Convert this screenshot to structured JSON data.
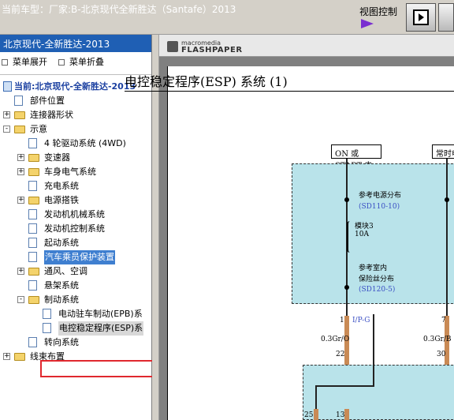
{
  "topbar": {
    "title": "当前车型：厂家:B-北京现代全新胜达（Santafe）2013",
    "view_control_label": "视图控制"
  },
  "sidebar": {
    "header": "北京现代-全新胜达-2013",
    "expand_label": "菜单展开",
    "collapse_label": "菜单折叠",
    "root_label": "当前:北京现代-全新胜达-2013",
    "items": [
      {
        "label": "部件位置",
        "type": "page",
        "level": 1
      },
      {
        "label": "连接器形状",
        "type": "folder",
        "level": 1,
        "expander": "+"
      },
      {
        "label": "示意",
        "type": "folder",
        "level": 1,
        "expander": "-"
      },
      {
        "label": "4 轮驱动系统 (4WD)",
        "type": "page",
        "level": 2
      },
      {
        "label": "变速器",
        "type": "folder",
        "level": 2,
        "expander": "+"
      },
      {
        "label": "车身电气系统",
        "type": "folder",
        "level": 2,
        "expander": "+"
      },
      {
        "label": "充电系统",
        "type": "page",
        "level": 2
      },
      {
        "label": "电源搭铁",
        "type": "folder",
        "level": 2,
        "expander": "+"
      },
      {
        "label": "发动机机械系统",
        "type": "page",
        "level": 2
      },
      {
        "label": "发动机控制系统",
        "type": "page",
        "level": 2
      },
      {
        "label": "起动系统",
        "type": "page",
        "level": 2
      },
      {
        "label": "汽车乘员保护装置",
        "type": "page",
        "level": 2,
        "highlighted": true
      },
      {
        "label": "通风、空调",
        "type": "folder",
        "level": 2,
        "expander": "+"
      },
      {
        "label": "悬架系统",
        "type": "page",
        "level": 2
      },
      {
        "label": "制动系统",
        "type": "folder",
        "level": 2,
        "expander": "-"
      },
      {
        "label": "电动驻车制动(EPB)系",
        "type": "page",
        "level": 3
      },
      {
        "label": "电控稳定程序(ESP)系",
        "type": "page",
        "level": 3,
        "selected": true
      },
      {
        "label": "转向系统",
        "type": "page",
        "level": 2
      },
      {
        "label": "线束布置",
        "type": "folder",
        "level": 1,
        "expander": "+"
      }
    ]
  },
  "viewer": {
    "logo_line1": "macromedia",
    "logo_line2": "FLASHPAPER",
    "doc_title": "电控稳定程序(ESP) 系统 (1)",
    "label_power": "ON 或START 电源",
    "label_power2": "常时电",
    "ref1": "参考电源分布",
    "ref1_code": "(SD110-10)",
    "fuse_name": "模块3",
    "fuse_amp": "10A",
    "ref2": "参考室内",
    "ref2_b": "保险丝分布",
    "ref2_code": "(SD120-5)",
    "pin_a": "1",
    "conn_a": "I/P-G",
    "wire_a": "0.3Gr/O",
    "num_a": "22",
    "pin_b": "7",
    "wire_b": "0.3Gr/B",
    "num_b": "30",
    "num_c": "25",
    "num_d": "13"
  }
}
